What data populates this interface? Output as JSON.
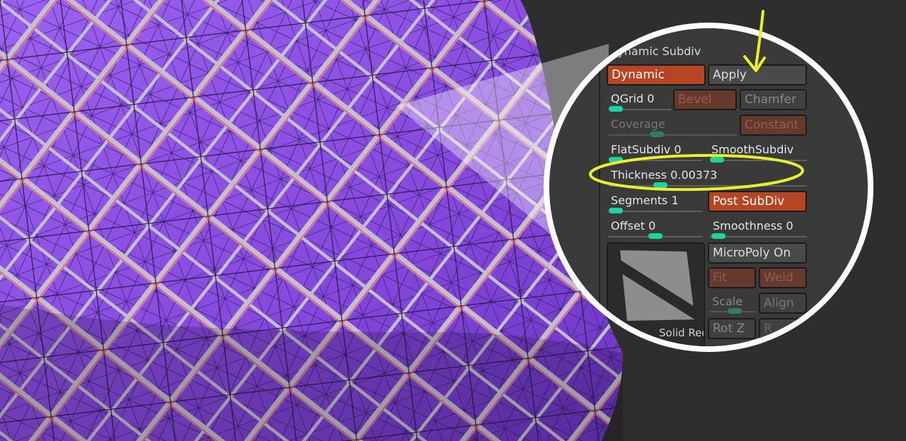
{
  "panel": {
    "title": "Dynamic Subdiv",
    "dynamic_label": "Dynamic",
    "apply_label": "Apply",
    "qgrid_label": "QGrid",
    "qgrid_value": "0",
    "bevel_label": "Bevel",
    "chamfer_label": "Chamfer",
    "coverage_label": "Coverage",
    "constant_label": "Constant",
    "flatsubdiv_label": "FlatSubdiv",
    "flatsubdiv_value": "0",
    "smoothsubdiv_label": "SmoothSubdiv",
    "thickness_label": "Thickness",
    "thickness_value": "0.00373",
    "segments_label": "Segments",
    "segments_value": "1",
    "postsubdiv_label": "Post SubDiv",
    "offset_label": "Offset",
    "offset_value": "0",
    "smoothness_label": "Smoothness",
    "smoothness_value": "0",
    "micropoly_label": "MicroPoly On",
    "fit_label": "Fit",
    "weld_label": "Weld",
    "scale_label": "Scale",
    "align_label": "Align",
    "solid_label": "Solid Rec",
    "rotz_label": "Rot Z",
    "extra_label": "R"
  },
  "colors": {
    "mesh_fill": "#8a4fe0",
    "mesh_light": "#a06cf0",
    "gap_color": "#bdb8c6",
    "edge_red": "#e8436a",
    "accent_orange": "#b64623",
    "slider_handle": "#19d6a1",
    "highlight_yellow": "#e9f028",
    "background": "#2e2e2e"
  }
}
